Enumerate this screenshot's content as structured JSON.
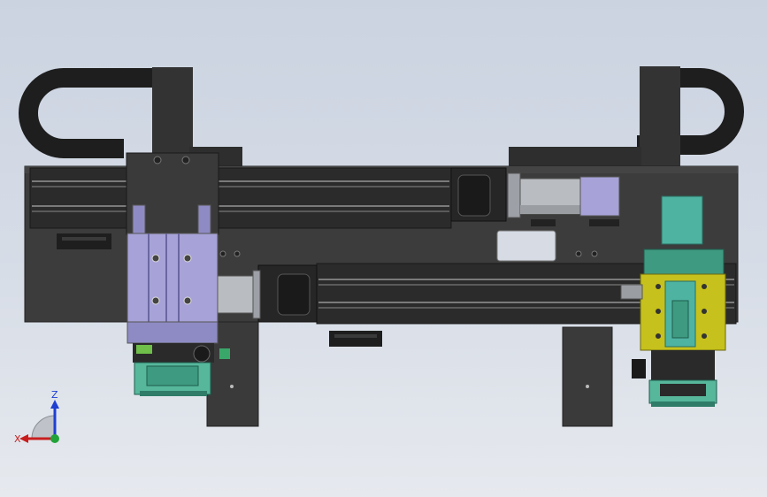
{
  "scene": {
    "type": "cad-assembly-front-view",
    "colors": {
      "background_top": "#cbd3e1",
      "background_bottom": "#e6e9ee",
      "frame": "#3a3a3a",
      "frame_dark": "#2e2e2e",
      "cable_chain": "#1e1e1e",
      "rail": "#5a5a5a",
      "motor_silver": "#b9bcc0",
      "motor_lilac": "#a7a2d8",
      "gripper_yellow": "#c6c11c",
      "gripper_teal": "#4fb3a2",
      "fixture_green": "#56b79b"
    }
  },
  "triad": {
    "z_label": "Z",
    "x_label": "X",
    "z_color": "#1f3fd1",
    "x_color": "#c81e1e",
    "origin_color": "#22a33a"
  }
}
